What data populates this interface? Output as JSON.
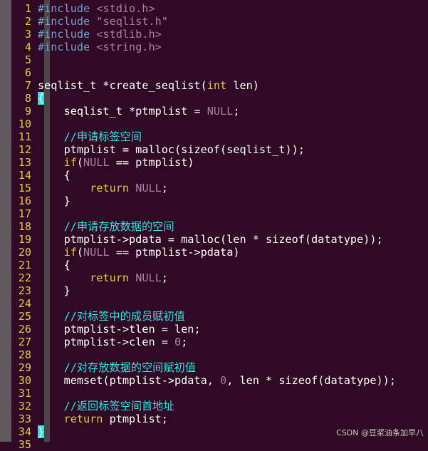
{
  "editor": {
    "lines": [
      {
        "n": "1",
        "tokens": [
          {
            "t": "#include ",
            "c": "pp"
          },
          {
            "t": "<stdio.h>",
            "c": "str"
          }
        ]
      },
      {
        "n": "2",
        "tokens": [
          {
            "t": "#include ",
            "c": "pp"
          },
          {
            "t": "\"seqlist.h\"",
            "c": "str"
          }
        ]
      },
      {
        "n": "3",
        "tokens": [
          {
            "t": "#include ",
            "c": "pp"
          },
          {
            "t": "<stdlib.h>",
            "c": "str"
          }
        ]
      },
      {
        "n": "4",
        "tokens": [
          {
            "t": "#include ",
            "c": "pp"
          },
          {
            "t": "<string.h>",
            "c": "str"
          }
        ]
      },
      {
        "n": "5",
        "tokens": []
      },
      {
        "n": "6",
        "tokens": []
      },
      {
        "n": "7",
        "tokens": [
          {
            "t": "seqlist_t *create_seqlist(",
            "c": "pl"
          },
          {
            "t": "int",
            "c": "kw"
          },
          {
            "t": " len)",
            "c": "pl"
          }
        ]
      },
      {
        "n": "8",
        "tokens": [
          {
            "t": "{",
            "c": "brace"
          }
        ],
        "cursor": true
      },
      {
        "n": "9",
        "tokens": [
          {
            "t": "    seqlist_t *ptmplist = ",
            "c": "pl"
          },
          {
            "t": "NULL",
            "c": "null"
          },
          {
            "t": ";",
            "c": "pl"
          }
        ]
      },
      {
        "n": "10",
        "tokens": []
      },
      {
        "n": "11",
        "tokens": [
          {
            "t": "    //申请标签空间",
            "c": "cm"
          }
        ]
      },
      {
        "n": "12",
        "tokens": [
          {
            "t": "    ptmplist = malloc(sizeof(seqlist_t));",
            "c": "pl"
          }
        ]
      },
      {
        "n": "13",
        "tokens": [
          {
            "t": "    ",
            "c": "pl"
          },
          {
            "t": "if",
            "c": "kw"
          },
          {
            "t": "(",
            "c": "pl"
          },
          {
            "t": "NULL",
            "c": "null"
          },
          {
            "t": " == ptmplist)",
            "c": "pl"
          }
        ]
      },
      {
        "n": "14",
        "tokens": [
          {
            "t": "    {",
            "c": "pl"
          }
        ]
      },
      {
        "n": "15",
        "tokens": [
          {
            "t": "        ",
            "c": "pl"
          },
          {
            "t": "return",
            "c": "kw"
          },
          {
            "t": " ",
            "c": "pl"
          },
          {
            "t": "NULL",
            "c": "null"
          },
          {
            "t": ";",
            "c": "pl"
          }
        ]
      },
      {
        "n": "16",
        "tokens": [
          {
            "t": "    }",
            "c": "pl"
          }
        ]
      },
      {
        "n": "17",
        "tokens": []
      },
      {
        "n": "18",
        "tokens": [
          {
            "t": "    //申请存放数据的空间",
            "c": "cm"
          }
        ]
      },
      {
        "n": "19",
        "tokens": [
          {
            "t": "    ptmplist->pdata = malloc(len * sizeof(datatype));",
            "c": "pl"
          }
        ]
      },
      {
        "n": "20",
        "tokens": [
          {
            "t": "    ",
            "c": "pl"
          },
          {
            "t": "if",
            "c": "kw"
          },
          {
            "t": "(",
            "c": "pl"
          },
          {
            "t": "NULL",
            "c": "null"
          },
          {
            "t": " == ptmplist->pdata)",
            "c": "pl"
          }
        ]
      },
      {
        "n": "21",
        "tokens": [
          {
            "t": "    {",
            "c": "pl"
          }
        ]
      },
      {
        "n": "22",
        "tokens": [
          {
            "t": "        ",
            "c": "pl"
          },
          {
            "t": "return",
            "c": "kw"
          },
          {
            "t": " ",
            "c": "pl"
          },
          {
            "t": "NULL",
            "c": "null"
          },
          {
            "t": ";",
            "c": "pl"
          }
        ]
      },
      {
        "n": "23",
        "tokens": [
          {
            "t": "    }",
            "c": "pl"
          }
        ]
      },
      {
        "n": "24",
        "tokens": []
      },
      {
        "n": "25",
        "tokens": [
          {
            "t": "    //对标签中的成员赋初值",
            "c": "cm"
          }
        ]
      },
      {
        "n": "26",
        "tokens": [
          {
            "t": "    ptmplist->tlen = len;",
            "c": "pl"
          }
        ]
      },
      {
        "n": "27",
        "tokens": [
          {
            "t": "    ptmplist->clen = ",
            "c": "pl"
          },
          {
            "t": "0",
            "c": "num"
          },
          {
            "t": ";",
            "c": "pl"
          }
        ]
      },
      {
        "n": "28",
        "tokens": []
      },
      {
        "n": "29",
        "tokens": [
          {
            "t": "    //对存放数据的空间赋初值",
            "c": "cm"
          }
        ]
      },
      {
        "n": "30",
        "tokens": [
          {
            "t": "    memset(ptmplist->pdata, ",
            "c": "pl"
          },
          {
            "t": "0",
            "c": "num"
          },
          {
            "t": ", len * sizeof(datatype));",
            "c": "pl"
          }
        ]
      },
      {
        "n": "31",
        "tokens": []
      },
      {
        "n": "32",
        "tokens": [
          {
            "t": "    //返回标签空间首地址",
            "c": "cm"
          }
        ]
      },
      {
        "n": "33",
        "tokens": [
          {
            "t": "    ",
            "c": "pl"
          },
          {
            "t": "return",
            "c": "kw"
          },
          {
            "t": " ptmplist;",
            "c": "pl"
          }
        ]
      },
      {
        "n": "34",
        "tokens": [
          {
            "t": "}",
            "c": "brace"
          }
        ],
        "cursor": true
      },
      {
        "n": "35",
        "tokens": []
      }
    ]
  },
  "watermark": "CSDN @豆浆油条加早八",
  "colors": {
    "background": "#300a24",
    "line_number": "#e7c547",
    "keyword": "#e7c547",
    "preprocessor": "#729fcf",
    "string_constant": "#ad7fa8",
    "comment": "#34e2e2"
  }
}
